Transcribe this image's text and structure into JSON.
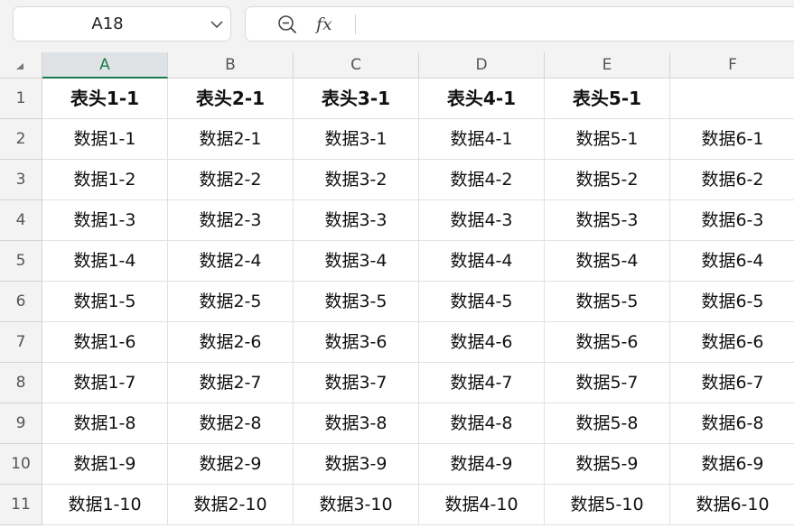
{
  "name_box": {
    "value": "A18"
  },
  "formula_bar": {
    "fx_label": "fx",
    "value": ""
  },
  "columns": [
    "A",
    "B",
    "C",
    "D",
    "E",
    "F"
  ],
  "active_column": "A",
  "rows": [
    {
      "num": "1",
      "cells": [
        "表头1-1",
        "表头2-1",
        "表头3-1",
        "表头4-1",
        "表头5-1",
        ""
      ]
    },
    {
      "num": "2",
      "cells": [
        "数据1-1",
        "数据2-1",
        "数据3-1",
        "数据4-1",
        "数据5-1",
        "数据6-1"
      ]
    },
    {
      "num": "3",
      "cells": [
        "数据1-2",
        "数据2-2",
        "数据3-2",
        "数据4-2",
        "数据5-2",
        "数据6-2"
      ]
    },
    {
      "num": "4",
      "cells": [
        "数据1-3",
        "数据2-3",
        "数据3-3",
        "数据4-3",
        "数据5-3",
        "数据6-3"
      ]
    },
    {
      "num": "5",
      "cells": [
        "数据1-4",
        "数据2-4",
        "数据3-4",
        "数据4-4",
        "数据5-4",
        "数据6-4"
      ]
    },
    {
      "num": "6",
      "cells": [
        "数据1-5",
        "数据2-5",
        "数据3-5",
        "数据4-5",
        "数据5-5",
        "数据6-5"
      ]
    },
    {
      "num": "7",
      "cells": [
        "数据1-6",
        "数据2-6",
        "数据3-6",
        "数据4-6",
        "数据5-6",
        "数据6-6"
      ]
    },
    {
      "num": "8",
      "cells": [
        "数据1-7",
        "数据2-7",
        "数据3-7",
        "数据4-7",
        "数据5-7",
        "数据6-7"
      ]
    },
    {
      "num": "9",
      "cells": [
        "数据1-8",
        "数据2-8",
        "数据3-8",
        "数据4-8",
        "数据5-8",
        "数据6-8"
      ]
    },
    {
      "num": "10",
      "cells": [
        "数据1-9",
        "数据2-9",
        "数据3-9",
        "数据4-9",
        "数据5-9",
        "数据6-9"
      ]
    },
    {
      "num": "11",
      "cells": [
        "数据1-10",
        "数据2-10",
        "数据3-10",
        "数据4-10",
        "数据5-10",
        "数据6-10"
      ]
    }
  ]
}
